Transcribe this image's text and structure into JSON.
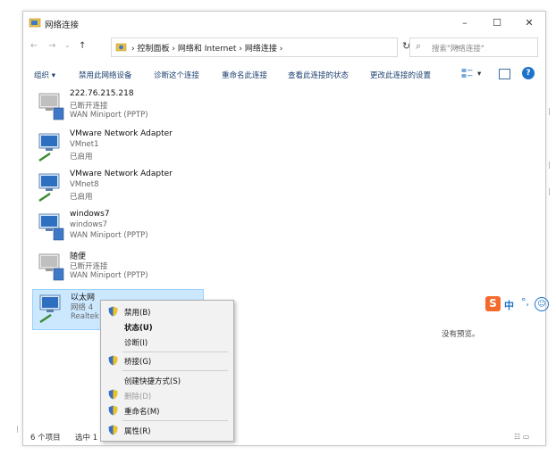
{
  "window": {
    "title": "网络连接",
    "controls": {
      "minimize": "–",
      "maximize": "☐",
      "close": "✕"
    }
  },
  "address": {
    "back": "←",
    "forward": "→",
    "recent": "⌄",
    "up": "↑",
    "crumbs": [
      "控制面板",
      "网络和 Internet",
      "网络连接"
    ],
    "crumb_sep": "›",
    "dropdown": "⌄",
    "refresh": "↻",
    "search_placeholder": "搜索\"网络连接\"",
    "search_icon": "⌕"
  },
  "toolbar": {
    "organize": "组织 ▾",
    "disable": "禁用此网络设备",
    "diagnose": "诊断这个连接",
    "rename": "重命名此连接",
    "status": "查看此连接的状态",
    "change": "更改此连接的设置",
    "view_drop": "▾",
    "help": "?"
  },
  "connections": [
    {
      "name": "222.76.215.218",
      "status": "已断开连接",
      "device": "WAN Miniport (PPTP)"
    },
    {
      "name": "VMware Network Adapter",
      "status": "VMnet1",
      "device": "已启用"
    },
    {
      "name": "VMware Network Adapter",
      "status": "VMnet8",
      "device": "已启用"
    },
    {
      "name": "windows7",
      "status": "windows7",
      "device": "WAN Miniport (PPTP)"
    },
    {
      "name": "随便",
      "status": "已断开连接",
      "device": "WAN Miniport (PPTP)"
    },
    {
      "name": "以太网",
      "status": "网络 4",
      "device": "Realtek"
    }
  ],
  "preview_text": "没有预览。",
  "statusbar": {
    "count": "6 个项目",
    "selected": "选中 1",
    "view_icons": "☷ ▭"
  },
  "context_menu": {
    "disable": "禁用(B)",
    "status": "状态(U)",
    "diagnose": "诊断(I)",
    "bridge": "桥接(G)",
    "shortcut": "创建快捷方式(S)",
    "delete": "删除(D)",
    "rename": "重命名(M)",
    "properties": "属性(R)"
  },
  "ime": {
    "logo": "S",
    "mode": "中",
    "punct": "°,",
    "emoji": "☺"
  },
  "colors": {
    "accent": "#1e73c8",
    "selection": "#cce8ff",
    "toolbar_text": "#1a3e6e",
    "ime_logo": "#f46b2d"
  }
}
